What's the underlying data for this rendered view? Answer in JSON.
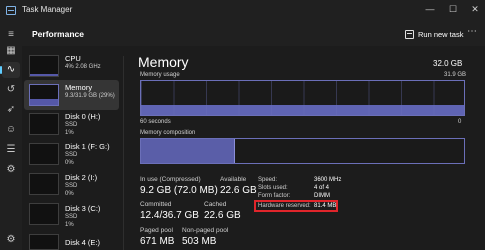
{
  "window": {
    "title": "Task Manager",
    "controls": {
      "minimize": "—",
      "maximize": "☐",
      "close": "✕"
    }
  },
  "rail": {
    "items": [
      {
        "icon": "menu-icon",
        "glyph": "≡"
      },
      {
        "icon": "processes-icon",
        "glyph": "▦"
      },
      {
        "icon": "performance-icon",
        "glyph": "∿"
      },
      {
        "icon": "app-history-icon",
        "glyph": "↺"
      },
      {
        "icon": "startup-apps-icon",
        "glyph": "➶"
      },
      {
        "icon": "users-icon",
        "glyph": "☺"
      },
      {
        "icon": "details-icon",
        "glyph": "☰"
      },
      {
        "icon": "services-icon",
        "glyph": "⚙"
      },
      {
        "icon": "settings-icon",
        "glyph": "⚙"
      }
    ]
  },
  "header": {
    "title": "Performance",
    "run_new_task": "Run new task",
    "more": "⋯"
  },
  "sidebar": {
    "items": [
      {
        "name": "CPU",
        "sub1": "4% 2.08 GHz",
        "sub2": ""
      },
      {
        "name": "Memory",
        "sub1": "9.3/31.9 GB (29%)",
        "sub2": ""
      },
      {
        "name": "Disk 0 (H:)",
        "sub1": "SSD",
        "sub2": "1%"
      },
      {
        "name": "Disk 1 (F: G:)",
        "sub1": "SSD",
        "sub2": "0%"
      },
      {
        "name": "Disk 2 (I:)",
        "sub1": "SSD",
        "sub2": "0%"
      },
      {
        "name": "Disk 3 (C:)",
        "sub1": "SSD",
        "sub2": "1%"
      },
      {
        "name": "Disk 4 (E:)",
        "sub1": "",
        "sub2": ""
      }
    ],
    "thumb_levels": {
      "cpu": 0.1,
      "memory": 0.29
    }
  },
  "main": {
    "title": "Memory",
    "total": "32.0 GB",
    "usage_label": "Memory usage",
    "usage_max": "31.9 GB",
    "usage_level": 0.29,
    "seconds_label": "60 seconds",
    "zero_label": "0",
    "composition_label": "Memory composition",
    "composition_in_use": 0.29,
    "stats": {
      "in_use_label": "In use (Compressed)",
      "in_use_value": "9.2 GB (72.0 MB)",
      "available_label": "Available",
      "available_value": "22.6 GB",
      "committed_label": "Committed",
      "committed_value": "12.4/36.7 GB",
      "cached_label": "Cached",
      "cached_value": "22.6 GB",
      "paged_pool_label": "Paged pool",
      "paged_pool_value": "671 MB",
      "non_paged_pool_label": "Non-paged pool",
      "non_paged_pool_value": "503 MB"
    },
    "specs": {
      "speed_label": "Speed:",
      "speed_value": "3600 MHz",
      "slots_label": "Slots used:",
      "slots_value": "4 of 4",
      "form_label": "Form factor:",
      "form_value": "DIMM",
      "hw_label": "Hardware reserved:",
      "hw_value": "81.4 MB"
    }
  },
  "colors": {
    "accent": "#60cdff",
    "graph_line": "#6b6fb8",
    "graph_fill": "#5f64b3",
    "highlight_box": "#e0252b"
  }
}
